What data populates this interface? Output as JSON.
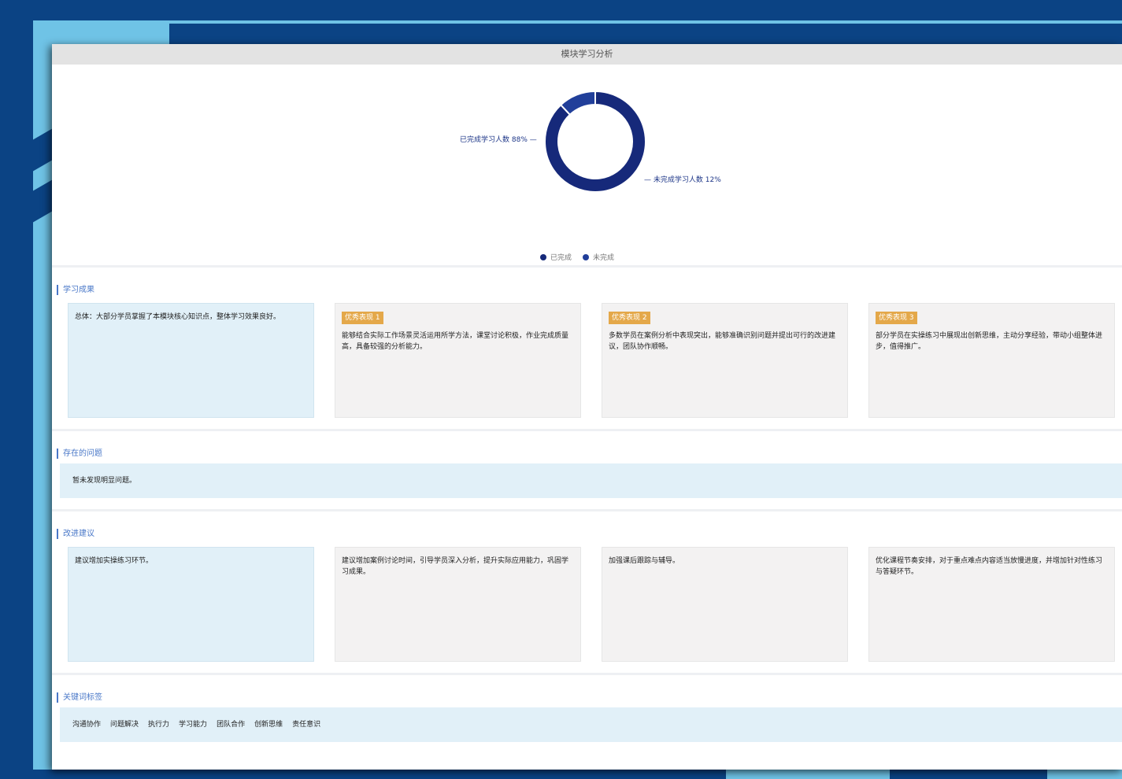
{
  "panel": {
    "title": "模块学习分析"
  },
  "chart_data": {
    "type": "pie",
    "variant": "donut",
    "slices": [
      {
        "label": "已完成",
        "callout": "已完成学习人数 88%",
        "value": 88,
        "color": "#16297a"
      },
      {
        "label": "未完成",
        "callout": "未完成学习人数 12%",
        "value": 12,
        "color": "#213f9a"
      }
    ],
    "legend": [
      "已完成",
      "未完成"
    ],
    "legend_position": "bottom"
  },
  "section_results": {
    "title": "学习成果",
    "summary": "总体：大部分学员掌握了本模块核心知识点，整体学习效果良好。",
    "cards": [
      {
        "tag": "优秀表现 1",
        "text": "能够结合实际工作场景灵活运用所学方法，课堂讨论积极，作业完成质量高，具备较强的分析能力。"
      },
      {
        "tag": "优秀表现 2",
        "text": "多数学员在案例分析中表现突出，能够准确识别问题并提出可行的改进建议，团队协作顺畅。"
      },
      {
        "tag": "优秀表现 3",
        "text": "部分学员在实操练习中展现出创新思维，主动分享经验，带动小组整体进步，值得推广。"
      }
    ]
  },
  "section_issues": {
    "title": "存在的问题",
    "text": "暂未发现明显问题。"
  },
  "section_suggestions": {
    "title": "改进建议",
    "summary": "建议增加实操练习环节。",
    "cards": [
      {
        "text": "建议增加案例讨论时间，引导学员深入分析，提升实际应用能力，巩固学习成果。"
      },
      {
        "text": "加强课后跟踪与辅导。"
      },
      {
        "text": "优化课程节奏安排，对于重点难点内容适当放慢进度，并增加针对性练习与答疑环节。"
      }
    ]
  },
  "section_keywords": {
    "title": "关键词标签",
    "tags": [
      "沟通协作",
      "问题解决",
      "执行力",
      "学习能力",
      "团队合作",
      "创新思维",
      "责任意识"
    ]
  }
}
